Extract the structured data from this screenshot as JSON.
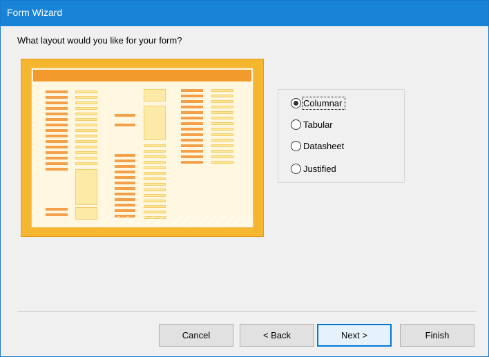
{
  "window": {
    "title": "Form Wizard"
  },
  "prompt": "What layout would you like for your form?",
  "layout_options": {
    "selected": "Columnar",
    "items": [
      {
        "label": "Columnar",
        "checked": true
      },
      {
        "label": "Tabular",
        "checked": false
      },
      {
        "label": "Datasheet",
        "checked": false
      },
      {
        "label": "Justified",
        "checked": false
      }
    ]
  },
  "buttons": {
    "cancel": "Cancel",
    "back": "< Back",
    "next": "Next >",
    "finish": "Finish"
  },
  "colors": {
    "title_bar": "#1883d7",
    "preview_frame": "#f7b62f",
    "preview_header": "#f39a2c",
    "accent_border": "#0078d7"
  }
}
